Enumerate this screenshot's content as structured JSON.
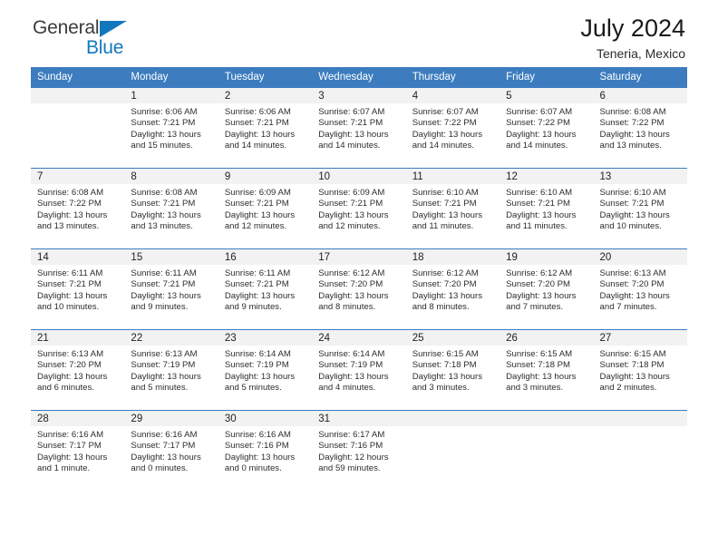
{
  "brand": {
    "line1": "General",
    "line2": "Blue",
    "triangle_icon": "brand-triangle-icon",
    "accent_color": "#1278be"
  },
  "header": {
    "title": "July 2024",
    "subtitle": "Teneria, Mexico"
  },
  "theme": {
    "header_blue": "#3c7cbf",
    "band_gray": "#f2f2f2",
    "text": "#222222"
  },
  "weekday_headers": [
    "Sunday",
    "Monday",
    "Tuesday",
    "Wednesday",
    "Thursday",
    "Friday",
    "Saturday"
  ],
  "weeks": [
    [
      {
        "day": "",
        "sunrise": "",
        "sunset": "",
        "daylight_line1": "",
        "daylight_line2": ""
      },
      {
        "day": "1",
        "sunrise": "Sunrise: 6:06 AM",
        "sunset": "Sunset: 7:21 PM",
        "daylight_line1": "Daylight: 13 hours",
        "daylight_line2": "and 15 minutes."
      },
      {
        "day": "2",
        "sunrise": "Sunrise: 6:06 AM",
        "sunset": "Sunset: 7:21 PM",
        "daylight_line1": "Daylight: 13 hours",
        "daylight_line2": "and 14 minutes."
      },
      {
        "day": "3",
        "sunrise": "Sunrise: 6:07 AM",
        "sunset": "Sunset: 7:21 PM",
        "daylight_line1": "Daylight: 13 hours",
        "daylight_line2": "and 14 minutes."
      },
      {
        "day": "4",
        "sunrise": "Sunrise: 6:07 AM",
        "sunset": "Sunset: 7:22 PM",
        "daylight_line1": "Daylight: 13 hours",
        "daylight_line2": "and 14 minutes."
      },
      {
        "day": "5",
        "sunrise": "Sunrise: 6:07 AM",
        "sunset": "Sunset: 7:22 PM",
        "daylight_line1": "Daylight: 13 hours",
        "daylight_line2": "and 14 minutes."
      },
      {
        "day": "6",
        "sunrise": "Sunrise: 6:08 AM",
        "sunset": "Sunset: 7:22 PM",
        "daylight_line1": "Daylight: 13 hours",
        "daylight_line2": "and 13 minutes."
      }
    ],
    [
      {
        "day": "7",
        "sunrise": "Sunrise: 6:08 AM",
        "sunset": "Sunset: 7:22 PM",
        "daylight_line1": "Daylight: 13 hours",
        "daylight_line2": "and 13 minutes."
      },
      {
        "day": "8",
        "sunrise": "Sunrise: 6:08 AM",
        "sunset": "Sunset: 7:21 PM",
        "daylight_line1": "Daylight: 13 hours",
        "daylight_line2": "and 13 minutes."
      },
      {
        "day": "9",
        "sunrise": "Sunrise: 6:09 AM",
        "sunset": "Sunset: 7:21 PM",
        "daylight_line1": "Daylight: 13 hours",
        "daylight_line2": "and 12 minutes."
      },
      {
        "day": "10",
        "sunrise": "Sunrise: 6:09 AM",
        "sunset": "Sunset: 7:21 PM",
        "daylight_line1": "Daylight: 13 hours",
        "daylight_line2": "and 12 minutes."
      },
      {
        "day": "11",
        "sunrise": "Sunrise: 6:10 AM",
        "sunset": "Sunset: 7:21 PM",
        "daylight_line1": "Daylight: 13 hours",
        "daylight_line2": "and 11 minutes."
      },
      {
        "day": "12",
        "sunrise": "Sunrise: 6:10 AM",
        "sunset": "Sunset: 7:21 PM",
        "daylight_line1": "Daylight: 13 hours",
        "daylight_line2": "and 11 minutes."
      },
      {
        "day": "13",
        "sunrise": "Sunrise: 6:10 AM",
        "sunset": "Sunset: 7:21 PM",
        "daylight_line1": "Daylight: 13 hours",
        "daylight_line2": "and 10 minutes."
      }
    ],
    [
      {
        "day": "14",
        "sunrise": "Sunrise: 6:11 AM",
        "sunset": "Sunset: 7:21 PM",
        "daylight_line1": "Daylight: 13 hours",
        "daylight_line2": "and 10 minutes."
      },
      {
        "day": "15",
        "sunrise": "Sunrise: 6:11 AM",
        "sunset": "Sunset: 7:21 PM",
        "daylight_line1": "Daylight: 13 hours",
        "daylight_line2": "and 9 minutes."
      },
      {
        "day": "16",
        "sunrise": "Sunrise: 6:11 AM",
        "sunset": "Sunset: 7:21 PM",
        "daylight_line1": "Daylight: 13 hours",
        "daylight_line2": "and 9 minutes."
      },
      {
        "day": "17",
        "sunrise": "Sunrise: 6:12 AM",
        "sunset": "Sunset: 7:20 PM",
        "daylight_line1": "Daylight: 13 hours",
        "daylight_line2": "and 8 minutes."
      },
      {
        "day": "18",
        "sunrise": "Sunrise: 6:12 AM",
        "sunset": "Sunset: 7:20 PM",
        "daylight_line1": "Daylight: 13 hours",
        "daylight_line2": "and 8 minutes."
      },
      {
        "day": "19",
        "sunrise": "Sunrise: 6:12 AM",
        "sunset": "Sunset: 7:20 PM",
        "daylight_line1": "Daylight: 13 hours",
        "daylight_line2": "and 7 minutes."
      },
      {
        "day": "20",
        "sunrise": "Sunrise: 6:13 AM",
        "sunset": "Sunset: 7:20 PM",
        "daylight_line1": "Daylight: 13 hours",
        "daylight_line2": "and 7 minutes."
      }
    ],
    [
      {
        "day": "21",
        "sunrise": "Sunrise: 6:13 AM",
        "sunset": "Sunset: 7:20 PM",
        "daylight_line1": "Daylight: 13 hours",
        "daylight_line2": "and 6 minutes."
      },
      {
        "day": "22",
        "sunrise": "Sunrise: 6:13 AM",
        "sunset": "Sunset: 7:19 PM",
        "daylight_line1": "Daylight: 13 hours",
        "daylight_line2": "and 5 minutes."
      },
      {
        "day": "23",
        "sunrise": "Sunrise: 6:14 AM",
        "sunset": "Sunset: 7:19 PM",
        "daylight_line1": "Daylight: 13 hours",
        "daylight_line2": "and 5 minutes."
      },
      {
        "day": "24",
        "sunrise": "Sunrise: 6:14 AM",
        "sunset": "Sunset: 7:19 PM",
        "daylight_line1": "Daylight: 13 hours",
        "daylight_line2": "and 4 minutes."
      },
      {
        "day": "25",
        "sunrise": "Sunrise: 6:15 AM",
        "sunset": "Sunset: 7:18 PM",
        "daylight_line1": "Daylight: 13 hours",
        "daylight_line2": "and 3 minutes."
      },
      {
        "day": "26",
        "sunrise": "Sunrise: 6:15 AM",
        "sunset": "Sunset: 7:18 PM",
        "daylight_line1": "Daylight: 13 hours",
        "daylight_line2": "and 3 minutes."
      },
      {
        "day": "27",
        "sunrise": "Sunrise: 6:15 AM",
        "sunset": "Sunset: 7:18 PM",
        "daylight_line1": "Daylight: 13 hours",
        "daylight_line2": "and 2 minutes."
      }
    ],
    [
      {
        "day": "28",
        "sunrise": "Sunrise: 6:16 AM",
        "sunset": "Sunset: 7:17 PM",
        "daylight_line1": "Daylight: 13 hours",
        "daylight_line2": "and 1 minute."
      },
      {
        "day": "29",
        "sunrise": "Sunrise: 6:16 AM",
        "sunset": "Sunset: 7:17 PM",
        "daylight_line1": "Daylight: 13 hours",
        "daylight_line2": "and 0 minutes."
      },
      {
        "day": "30",
        "sunrise": "Sunrise: 6:16 AM",
        "sunset": "Sunset: 7:16 PM",
        "daylight_line1": "Daylight: 13 hours",
        "daylight_line2": "and 0 minutes."
      },
      {
        "day": "31",
        "sunrise": "Sunrise: 6:17 AM",
        "sunset": "Sunset: 7:16 PM",
        "daylight_line1": "Daylight: 12 hours",
        "daylight_line2": "and 59 minutes."
      },
      {
        "day": "",
        "sunrise": "",
        "sunset": "",
        "daylight_line1": "",
        "daylight_line2": ""
      },
      {
        "day": "",
        "sunrise": "",
        "sunset": "",
        "daylight_line1": "",
        "daylight_line2": ""
      },
      {
        "day": "",
        "sunrise": "",
        "sunset": "",
        "daylight_line1": "",
        "daylight_line2": ""
      }
    ]
  ]
}
